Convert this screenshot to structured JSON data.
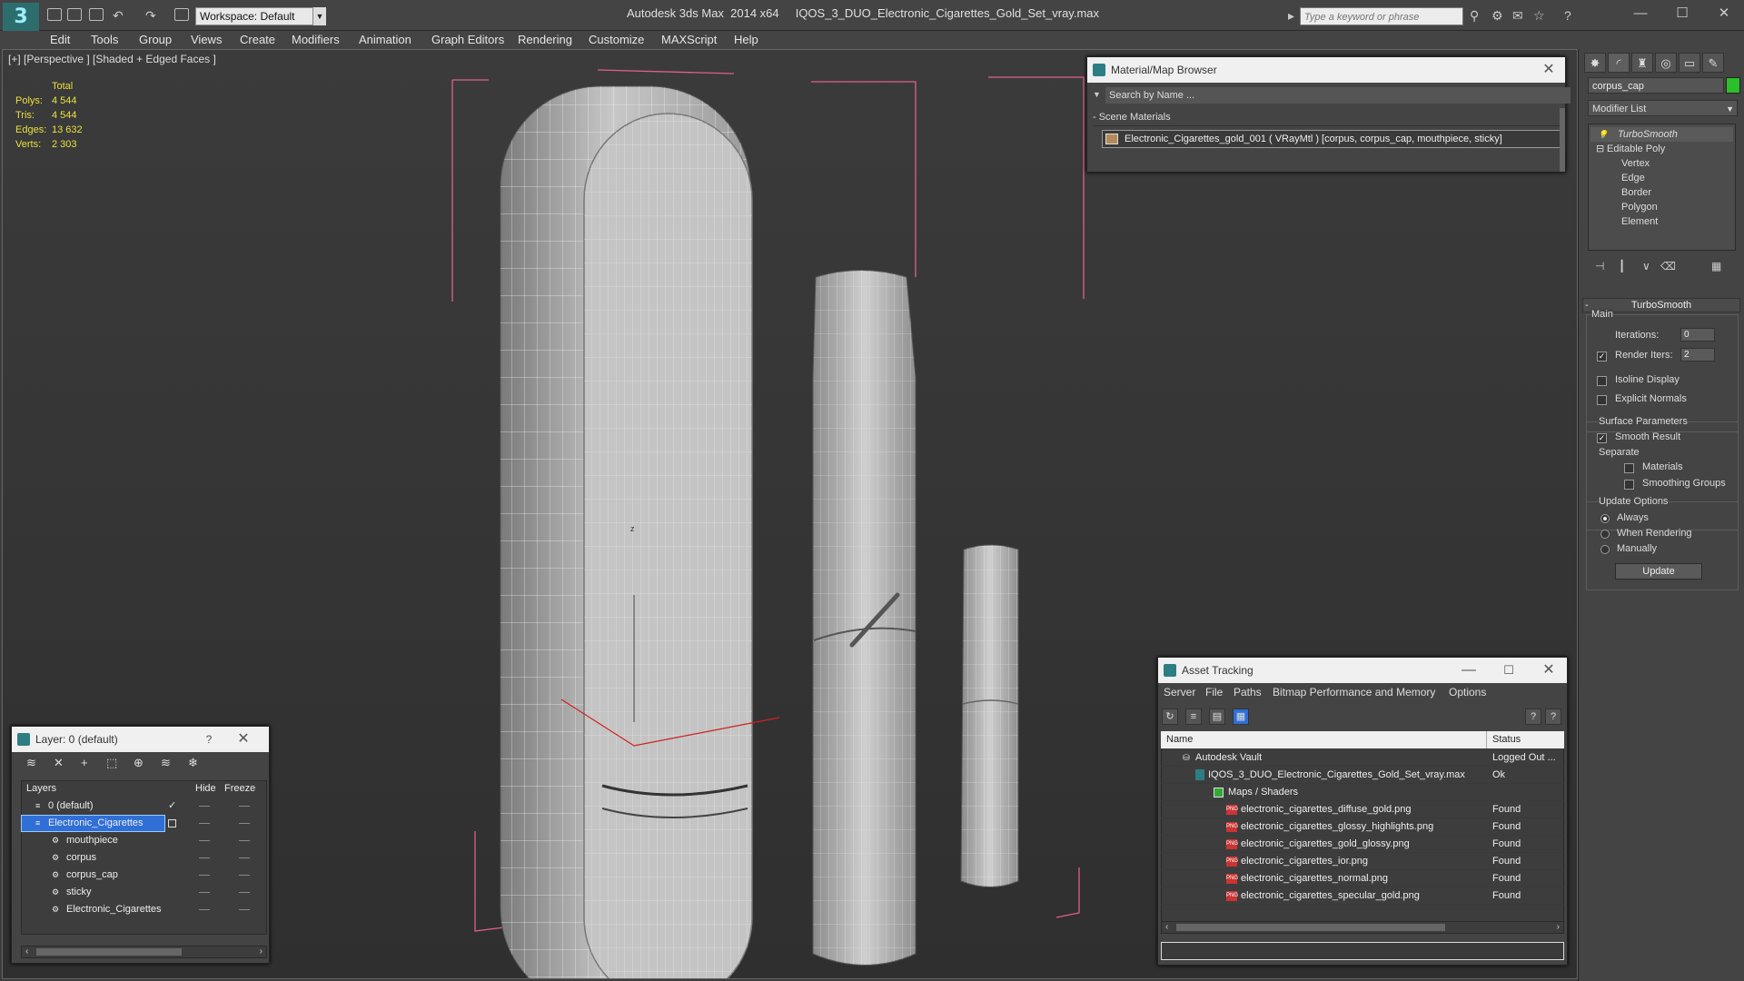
{
  "app": {
    "title": "Autodesk 3ds Max  2014 x64     IQOS_3_DUO_Electronic_Cigarettes_Gold_Set_vray.max",
    "workspace": "Workspace: Default",
    "search_placeholder": "Type a keyword or phrase",
    "logo_glyph": "3"
  },
  "menu": [
    "Edit",
    "Tools",
    "Group",
    "Views",
    "Create",
    "Modifiers",
    "Animation",
    "Graph Editors",
    "Rendering",
    "Customize",
    "MAXScript",
    "Help"
  ],
  "viewport": {
    "label": "[+] [Perspective ] [Shaded + Edged Faces ]",
    "stats": {
      "header": "Total",
      "rows": [
        {
          "label": "Polys:",
          "value": "4 544"
        },
        {
          "label": "Tris:",
          "value": "4 544"
        },
        {
          "label": "Edges:",
          "value": "13 632"
        },
        {
          "label": "Verts:",
          "value": "2 303"
        }
      ]
    },
    "axis_label": "z"
  },
  "material_browser": {
    "title": "Material/Map Browser",
    "search_placeholder": "Search by Name ...",
    "section": "- Scene Materials",
    "item": "Electronic_Cigarettes_gold_001  ( VRayMtl ) [corpus, corpus_cap, mouthpiece, sticky]"
  },
  "command_panel": {
    "object_name": "corpus_cap",
    "modifier_list": "Modifier List",
    "stack": [
      "TurboSmooth",
      "Editable Poly",
      "Vertex",
      "Edge",
      "Border",
      "Polygon",
      "Element"
    ],
    "rollout_title": "TurboSmooth",
    "main_label": "Main",
    "iterations_label": "Iterations:",
    "iterations_value": "0",
    "render_iters_label": "Render Iters:",
    "render_iters_value": "2",
    "isoline": "Isoline Display",
    "explicit_normals": "Explicit Normals",
    "surface_params": "Surface Parameters",
    "smooth_result": "Smooth Result",
    "separate": "Separate",
    "materials": "Materials",
    "smoothing_groups": "Smoothing Groups",
    "update_options": "Update Options",
    "always": "Always",
    "when_rendering": "When Rendering",
    "manually": "Manually",
    "update_button": "Update"
  },
  "layer_explorer": {
    "title": "Layer: 0 (default)",
    "help": "?",
    "col_layers": "Layers",
    "col_hide": "Hide",
    "col_freeze": "Freeze",
    "rows": [
      {
        "name": "0 (default)"
      },
      {
        "name": "Electronic_Cigarettes"
      },
      {
        "name": "mouthpiece"
      },
      {
        "name": "corpus"
      },
      {
        "name": "corpus_cap"
      },
      {
        "name": "sticky"
      },
      {
        "name": "Electronic_Cigarettes"
      }
    ]
  },
  "asset_tracking": {
    "title": "Asset Tracking",
    "menu": [
      "Server",
      "File",
      "Paths",
      "Bitmap Performance and Memory",
      "Options"
    ],
    "col_name": "Name",
    "col_status": "Status",
    "rows": [
      {
        "name": "Autodesk Vault",
        "status": "Logged Out ..."
      },
      {
        "name": "IQOS_3_DUO_Electronic_Cigarettes_Gold_Set_vray.max",
        "status": "Ok"
      },
      {
        "name": "Maps / Shaders",
        "status": ""
      },
      {
        "name": "electronic_cigarettes_diffuse_gold.png",
        "status": "Found"
      },
      {
        "name": "electronic_cigarettes_glossy_highlights.png",
        "status": "Found"
      },
      {
        "name": "electronic_cigarettes_gold_glossy.png",
        "status": "Found"
      },
      {
        "name": "electronic_cigarettes_ior.png",
        "status": "Found"
      },
      {
        "name": "electronic_cigarettes_normal.png",
        "status": "Found"
      },
      {
        "name": "electronic_cigarettes_specular_gold.png",
        "status": "Found"
      }
    ]
  },
  "colors": {
    "viewport_bg": "#363636",
    "stats_text": "#e8e040",
    "selection_blue": "#2f6fd6",
    "bracket_pink": "#e0608a",
    "object_color": "#2bbf2b"
  }
}
